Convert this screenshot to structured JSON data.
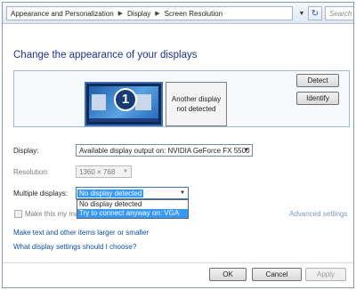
{
  "address_bar": {
    "breadcrumbs": [
      "Appearance and Personalization",
      "Display",
      "Screen Resolution"
    ],
    "search_placeholder": "Search C"
  },
  "page": {
    "title": "Change the appearance of your displays"
  },
  "monitors": {
    "primary_number": "1",
    "secondary_label_line1": "Another display",
    "secondary_label_line2": "not detected"
  },
  "buttons": {
    "detect": "Detect",
    "identify": "Identify",
    "ok": "OK",
    "cancel": "Cancel",
    "apply": "Apply"
  },
  "settings": {
    "display_label": "Display:",
    "display_value": "Available display output on: NVIDIA GeForce FX 5500",
    "resolution_label": "Resolution:",
    "resolution_value": "1360 × 768",
    "multiple_label": "Multiple displays:",
    "multiple_value": "No display detected",
    "multiple_options": [
      "No display detected",
      "Try to connect anyway on: VGA"
    ],
    "checkbox_label_partial": "Make this my ma",
    "advanced_link": "Advanced settings"
  },
  "links": {
    "text_size": "Make text and other items larger or smaller",
    "help": "What display settings should I choose?"
  },
  "icons": {
    "breadcrumb_separator": "▶",
    "dropdown_arrow": "▼",
    "refresh": "↻"
  }
}
